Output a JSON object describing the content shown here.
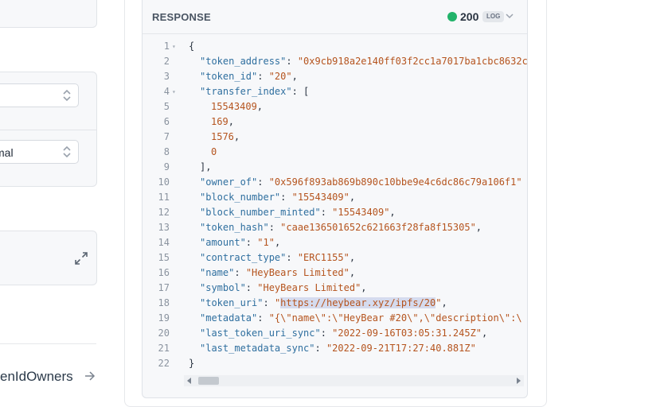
{
  "left_panel": {
    "select_bottom_value": "mal",
    "endpoint_label": "enIdOwners"
  },
  "response": {
    "title": "RESPONSE",
    "status_code": "200",
    "log_label": "LOG",
    "status_color": "#22b36a"
  },
  "code_lines": [
    {
      "n": "1",
      "fold": true,
      "indent": 0,
      "parts": [
        {
          "t": "{",
          "c": "p"
        }
      ]
    },
    {
      "n": "2",
      "indent": 1,
      "parts": [
        {
          "t": "\"token_address\"",
          "c": "k"
        },
        {
          "t": ": ",
          "c": "p"
        },
        {
          "t": "\"0x9cb918a2e140ff03f2cc1a7017ba1cbc8632c",
          "c": "s"
        }
      ]
    },
    {
      "n": "3",
      "indent": 1,
      "parts": [
        {
          "t": "\"token_id\"",
          "c": "k"
        },
        {
          "t": ": ",
          "c": "p"
        },
        {
          "t": "\"20\"",
          "c": "s"
        },
        {
          "t": ",",
          "c": "p"
        }
      ]
    },
    {
      "n": "4",
      "fold": true,
      "indent": 1,
      "parts": [
        {
          "t": "\"transfer_index\"",
          "c": "k"
        },
        {
          "t": ": [",
          "c": "p"
        }
      ]
    },
    {
      "n": "5",
      "indent": 2,
      "parts": [
        {
          "t": "15543409",
          "c": "n"
        },
        {
          "t": ",",
          "c": "p"
        }
      ]
    },
    {
      "n": "6",
      "indent": 2,
      "parts": [
        {
          "t": "169",
          "c": "n"
        },
        {
          "t": ",",
          "c": "p"
        }
      ]
    },
    {
      "n": "7",
      "indent": 2,
      "parts": [
        {
          "t": "1576",
          "c": "n"
        },
        {
          "t": ",",
          "c": "p"
        }
      ]
    },
    {
      "n": "8",
      "indent": 2,
      "parts": [
        {
          "t": "0",
          "c": "n"
        }
      ]
    },
    {
      "n": "9",
      "indent": 1,
      "parts": [
        {
          "t": "],",
          "c": "p"
        }
      ]
    },
    {
      "n": "10",
      "indent": 1,
      "parts": [
        {
          "t": "\"owner_of\"",
          "c": "k"
        },
        {
          "t": ": ",
          "c": "p"
        },
        {
          "t": "\"0x596f893ab869b890c10bbe9e4c6dc86c79a106f1\"",
          "c": "s"
        }
      ]
    },
    {
      "n": "11",
      "indent": 1,
      "parts": [
        {
          "t": "\"block_number\"",
          "c": "k"
        },
        {
          "t": ": ",
          "c": "p"
        },
        {
          "t": "\"15543409\"",
          "c": "s"
        },
        {
          "t": ",",
          "c": "p"
        }
      ]
    },
    {
      "n": "12",
      "indent": 1,
      "parts": [
        {
          "t": "\"block_number_minted\"",
          "c": "k"
        },
        {
          "t": ": ",
          "c": "p"
        },
        {
          "t": "\"15543409\"",
          "c": "s"
        },
        {
          "t": ",",
          "c": "p"
        }
      ]
    },
    {
      "n": "13",
      "indent": 1,
      "parts": [
        {
          "t": "\"token_hash\"",
          "c": "k"
        },
        {
          "t": ": ",
          "c": "p"
        },
        {
          "t": "\"caae136501652c621663f28fa8f15305\"",
          "c": "s"
        },
        {
          "t": ",",
          "c": "p"
        }
      ]
    },
    {
      "n": "14",
      "indent": 1,
      "parts": [
        {
          "t": "\"amount\"",
          "c": "k"
        },
        {
          "t": ": ",
          "c": "p"
        },
        {
          "t": "\"1\"",
          "c": "s"
        },
        {
          "t": ",",
          "c": "p"
        }
      ]
    },
    {
      "n": "15",
      "indent": 1,
      "parts": [
        {
          "t": "\"contract_type\"",
          "c": "k"
        },
        {
          "t": ": ",
          "c": "p"
        },
        {
          "t": "\"ERC1155\"",
          "c": "s"
        },
        {
          "t": ",",
          "c": "p"
        }
      ]
    },
    {
      "n": "16",
      "indent": 1,
      "parts": [
        {
          "t": "\"name\"",
          "c": "k"
        },
        {
          "t": ": ",
          "c": "p"
        },
        {
          "t": "\"HeyBears Limited\"",
          "c": "s"
        },
        {
          "t": ",",
          "c": "p"
        }
      ]
    },
    {
      "n": "17",
      "indent": 1,
      "parts": [
        {
          "t": "\"symbol\"",
          "c": "k"
        },
        {
          "t": ": ",
          "c": "p"
        },
        {
          "t": "\"HeyBears Limited\"",
          "c": "s"
        },
        {
          "t": ",",
          "c": "p"
        }
      ]
    },
    {
      "n": "18",
      "indent": 1,
      "parts": [
        {
          "t": "\"token_uri\"",
          "c": "k"
        },
        {
          "t": ": ",
          "c": "p"
        },
        {
          "t": "\"",
          "c": "s"
        },
        {
          "t": "https://heybear.xyz/ipfs/20",
          "c": "s",
          "hl": true
        },
        {
          "t": "\"",
          "c": "s"
        },
        {
          "t": ",",
          "c": "p"
        }
      ]
    },
    {
      "n": "19",
      "indent": 1,
      "parts": [
        {
          "t": "\"metadata\"",
          "c": "k"
        },
        {
          "t": ": ",
          "c": "p"
        },
        {
          "t": "\"{\\\"name\\\":\\\"HeyBear #20\\\",\\\"description\\\":\\",
          "c": "s"
        }
      ]
    },
    {
      "n": "20",
      "indent": 1,
      "parts": [
        {
          "t": "\"last_token_uri_sync\"",
          "c": "k"
        },
        {
          "t": ": ",
          "c": "p"
        },
        {
          "t": "\"2022-09-16T03:05:31.245Z\"",
          "c": "s"
        },
        {
          "t": ",",
          "c": "p"
        }
      ]
    },
    {
      "n": "21",
      "indent": 1,
      "parts": [
        {
          "t": "\"last_metadata_sync\"",
          "c": "k"
        },
        {
          "t": ": ",
          "c": "p"
        },
        {
          "t": "\"2022-09-21T17:27:40.881Z\"",
          "c": "s"
        }
      ]
    },
    {
      "n": "22",
      "indent": 0,
      "parts": [
        {
          "t": "}",
          "c": "p"
        }
      ]
    }
  ]
}
